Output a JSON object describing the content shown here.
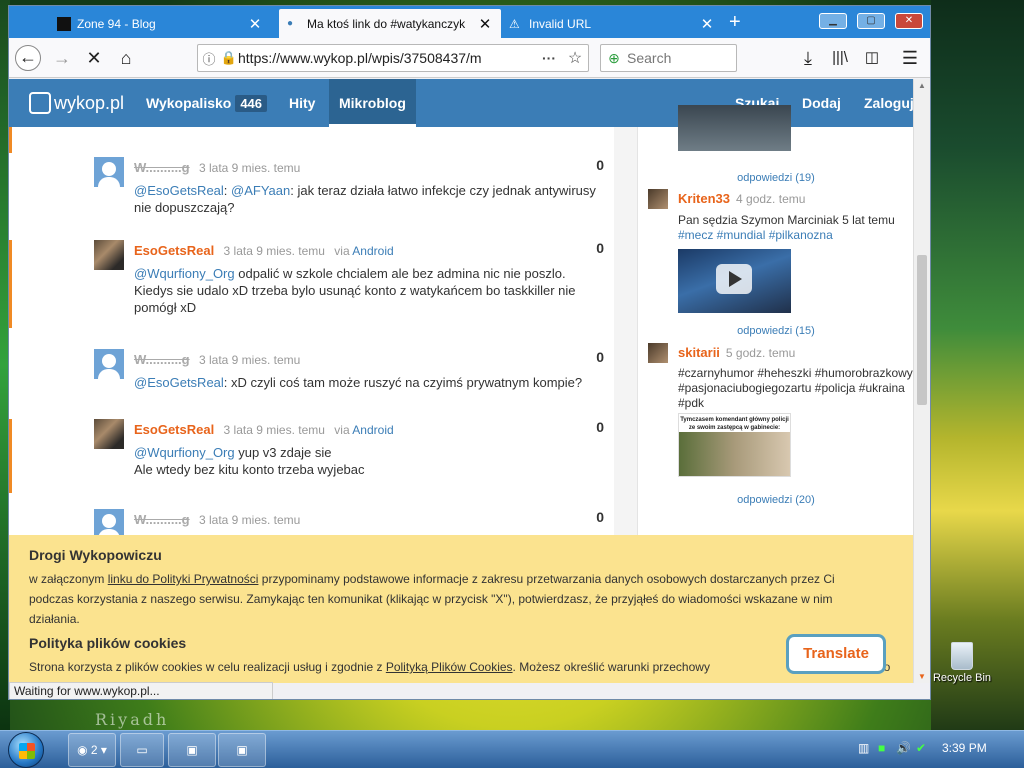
{
  "browser": {
    "tabs": [
      {
        "title": "Zone 94 - Blog",
        "active": false
      },
      {
        "title": "Ma ktoś link do #watykanczyk",
        "active": true
      },
      {
        "title": "Invalid URL",
        "active": false
      }
    ],
    "url": "https://www.wykop.pl/wpis/37508437/m",
    "search_placeholder": "Search",
    "status": "Waiting for www.wykop.pl..."
  },
  "site": {
    "logo": "wykop.pl",
    "nav": [
      {
        "label": "Wykopalisko",
        "badge": "446"
      },
      {
        "label": "Hity"
      },
      {
        "label": "Mikroblog",
        "active": true
      }
    ],
    "nav_right": [
      "Szukaj",
      "Dodaj",
      "Zaloguj"
    ]
  },
  "comments": [
    {
      "user": "W..........g",
      "time": "3 lata 9 mies. temu",
      "via": "",
      "score": "0",
      "text": "@EsoGetsReal: @AFYaan: jak teraz działa łatwo infekcje czy jednak antywirusy nie dopuszczają?"
    },
    {
      "user": "EsoGetsReal",
      "time": "3 lata 9 mies. temu",
      "via": "Android",
      "score": "0",
      "text": "@Wqurfiony_Org odpalić w szkole chcialem ale bez admina nic nie poszlo. Kiedys sie udalo xD trzeba bylo usunąć konto z watykańcem bo taskkiller nie pomógł xD"
    },
    {
      "user": "W..........g",
      "time": "3 lata 9 mies. temu",
      "via": "",
      "score": "0",
      "text": "@EsoGetsReal: xD czyli coś tam może ruszyć na czyimś prywatnym kompie?"
    },
    {
      "user": "EsoGetsReal",
      "time": "3 lata 9 mies. temu",
      "via": "Android",
      "score": "0",
      "text": "@Wqurfiony_Org yup v3 zdaje sie\nAle wtedy bez kitu konto trzeba wyjebac"
    },
    {
      "user": "W..........g",
      "time": "3 lata 9 mies. temu",
      "via": "",
      "score": "0",
      "text": ""
    }
  ],
  "sidebar": {
    "replies": [
      "odpowiedzi (19)",
      "odpowiedzi (15)",
      "odpowiedzi (20)"
    ],
    "posts": [
      {
        "user": "Kriten33",
        "time": "4 godz. temu",
        "text": "Pan sędzia Szymon Marciniak 5 lat temu",
        "tags": "#mecz #mundial #pilkanozna"
      },
      {
        "user": "skitarii",
        "time": "5 godz. temu",
        "tags": "#czarnyhumor #heheszki #humorobrazkowy #pasjonaciubogiegozartu #policja #ukraina #pdk",
        "meme_caption": "Tymczasem komendant główny policji ze swoim zastępcą w gabinecie:"
      }
    ]
  },
  "cookie": {
    "title": "Drogi Wykopowiczu",
    "p1_a": "w załączonym ",
    "p1_link": "linku do Polityki Prywatności",
    "p1_b": " przypominamy podstawowe informacje z zakresu przetwarzania danych osobowych dostarczanych przez Ci",
    "p1_c": "podczas korzystania z naszego serwisu. Zamykając ten komunikat (klikając w przycisk \"X\"), potwierdzasz, że przyjąłeś do wiadomości wskazane w nim",
    "p1_d": "działania.",
    "title2": "Polityka plików cookies",
    "p2_a": "Strona korzysta z plików cookies w celu realizacji usług i zgodnie z ",
    "p2_link": "Polityką Plików Cookies",
    "p2_b": ". Możesz określić warunki przechowy",
    "p2_c": "do"
  },
  "translate": "Translate",
  "desktop": {
    "recycle": "Recycle Bin",
    "wallpaper_text": "Riyadh"
  },
  "taskbar": {
    "group_count": "2",
    "clock": "3:39 PM"
  }
}
